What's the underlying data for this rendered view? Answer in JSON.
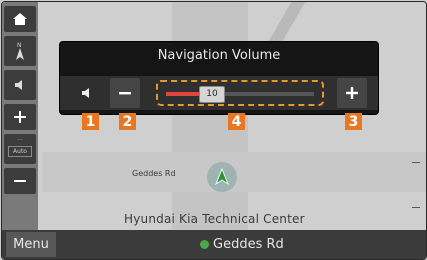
{
  "popup": {
    "title": "Navigation Volume",
    "volume_level": 10,
    "volume_max": 40,
    "volume_label": "10"
  },
  "map": {
    "street_label": "Geddes Rd",
    "poi_label": "Hyundai Kia Technical Center"
  },
  "bottom_bar": {
    "menu_label": "Menu",
    "current_road": "Geddes Rd"
  },
  "side_panel": {
    "auto_label": "Auto"
  },
  "callouts": [
    "1",
    "2",
    "3",
    "4"
  ],
  "colors": {
    "accent_orange": "#e87722",
    "slider_fill": "#e0463d",
    "slider_outline": "#e39a2b",
    "popup_bg": "#151515"
  },
  "icons": [
    "home-icon",
    "north-icon",
    "sound-icon",
    "zoom-in-icon",
    "zoom-out-icon",
    "speaker-icon",
    "minus-icon",
    "plus-icon",
    "car-position-icon",
    "location-dot-icon"
  ]
}
